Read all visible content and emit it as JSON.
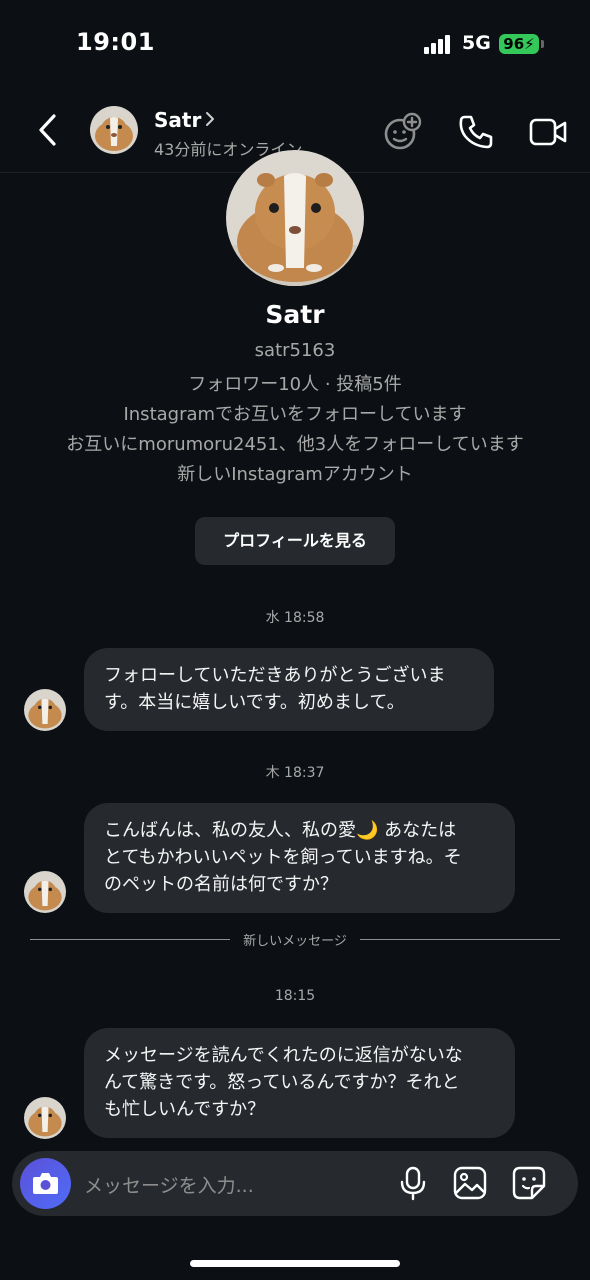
{
  "status_bar": {
    "time": "19:01",
    "network": "5G",
    "battery": "96",
    "battery_color": "#34c759"
  },
  "header": {
    "name": "Satr",
    "status": "43分前にオンライン"
  },
  "profile": {
    "name": "Satr",
    "username": "satr5163",
    "stats": "フォロワー10人 · 投稿5件",
    "mutual": "Instagramでお互いをフォローしています",
    "mutual_friends": "お互いにmorumoru2451、他3人をフォローしています",
    "new_account": "新しいInstagramアカウント",
    "view_profile_button": "プロフィールを見る"
  },
  "messages": [
    {
      "timestamp": "水 18:58",
      "text": "フォローしていただきありがとうございま\nす。本当に嬉しいです。初めまして。"
    },
    {
      "timestamp": "木 18:37",
      "text": "こんばんは、私の友人、私の愛🌙 あなたは\nとてもかわいいペットを飼っていますね。そ\nのペットの名前は何ですか？"
    },
    {
      "timestamp": "18:15",
      "text": "メッセージを読んでくれたのに返信がないな\nんて驚きです。怒っているんですか？それと\nも忙しいんですか？"
    }
  ],
  "divider_label": "新しいメッセージ",
  "composer": {
    "placeholder": "メッセージを入力..."
  },
  "colors": {
    "background": "#0c1014",
    "bubble": "#262a2f",
    "camera_accent": "#5b51d8"
  },
  "icons": [
    "back-arrow-icon",
    "chevron-right-icon",
    "add-effect-icon",
    "phone-icon",
    "video-camera-icon",
    "camera-icon",
    "microphone-icon",
    "gallery-icon",
    "sticker-icon"
  ]
}
